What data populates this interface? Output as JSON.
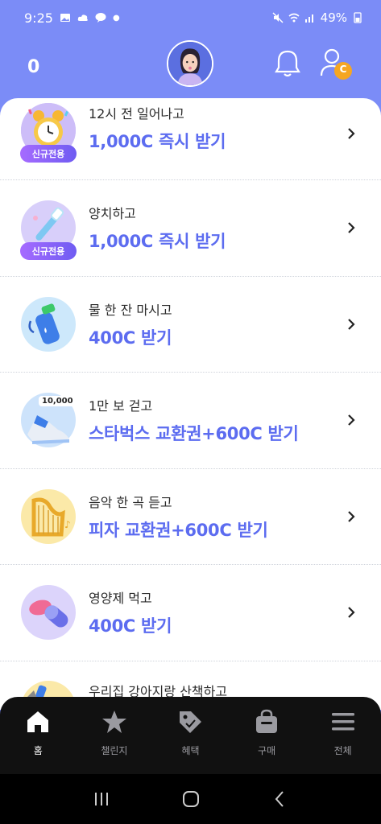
{
  "status_bar": {
    "time": "9:25",
    "battery": "49%"
  },
  "header": {
    "coins": "0",
    "profile_badge": "C"
  },
  "missions": [
    {
      "title": "12시 전 일어나고",
      "reward": "1,000C 즉시 받기",
      "badge": "신규전용",
      "icon": "alarm-clock-icon"
    },
    {
      "title": "양치하고",
      "reward": "1,000C 즉시 받기",
      "badge": "신규전용",
      "icon": "toothbrush-icon"
    },
    {
      "title": "물 한 잔 마시고",
      "reward": "400C 받기",
      "icon": "water-bottle-icon"
    },
    {
      "title": "1만 보 걷고",
      "reward": "스타벅스 교환권+600C 받기",
      "icon": "sneaker-icon",
      "tag": "10,000"
    },
    {
      "title": "음악 한 곡 듣고",
      "reward": "피자 교환권+600C 받기",
      "icon": "harp-icon"
    },
    {
      "title": "영양제 먹고",
      "reward": "400C 받기",
      "icon": "pill-icon"
    },
    {
      "title": "우리집 강아지랑 산책하고",
      "icon": "dog-icon"
    }
  ],
  "nav": [
    {
      "label": "홈",
      "icon": "home-icon",
      "active": true
    },
    {
      "label": "챌린지",
      "icon": "star-icon"
    },
    {
      "label": "혜택",
      "icon": "tag-icon"
    },
    {
      "label": "구매",
      "icon": "bag-icon"
    },
    {
      "label": "전체",
      "icon": "menu-icon"
    }
  ],
  "colors": {
    "brand": "#7B8CF7",
    "reward_text": "#5C6CF0",
    "nav_bg": "#111111"
  }
}
